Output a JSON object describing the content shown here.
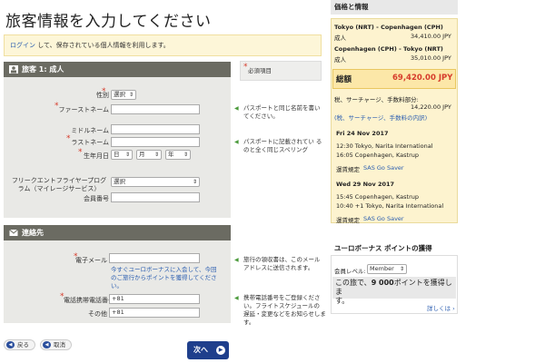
{
  "page": {
    "title": "旅客情報を入力してください"
  },
  "login": {
    "link": "ログイン",
    "text": " して、保存されている個人情報を利用します。"
  },
  "passenger": {
    "header": "旅客 1: 成人",
    "gender_label": "性別",
    "gender_value": "選択",
    "first_name_label": "ファーストネーム",
    "middle_name_label": "ミドルネーム",
    "last_name_label": "ラストネーム",
    "birthdate_label": "生年月日",
    "day_value": "日",
    "month_value": "月",
    "year_value": "年",
    "ffp_label_1": "フリークエントフライヤープログ",
    "ffp_label_2": "ラム（マイレージサービス）",
    "ffp_value": "選択",
    "member_no_label": "会員番号"
  },
  "required_note": "必須項目",
  "help": {
    "first_name_1": "パスポートと同じ名前を書い",
    "first_name_2": "てください。",
    "last_name_1": "パスポートに記載されてい る",
    "last_name_2": "のと全く同じスペリング",
    "email_1": "旅行の領収書は、このメール",
    "email_2": "アドレスに送信されます。",
    "phone_1": "携帯電話番号をご登録くださ",
    "phone_2": "い。フライトスケジュールの",
    "phone_3": "遅延・変更などをお知らせします。"
  },
  "contact": {
    "header": "連絡先",
    "email_label": "電子メール",
    "eurobonus_1": "今すぐユーロボーナスに入会して、今回",
    "eurobonus_2": "のご旅行からポイントを獲得してくださ",
    "eurobonus_3": "い。",
    "phone_label": "電話",
    "mobile_label": "携帯電話番号",
    "mobile_value": "+81",
    "other_label": "その他",
    "other_value": "+81"
  },
  "buttons": {
    "back": "戻る",
    "cancel": "取消",
    "next": "次へ"
  },
  "sidebar": {
    "price_header": "価格と情報",
    "route1": "Tokyo (NRT) - Copenhagen (CPH)",
    "route1_pax": "成人",
    "route1_price": "34,410.00 JPY",
    "route2": "Copenhagen (CPH) - Tokyo (NRT)",
    "route2_pax": "成人",
    "route2_price": "35,010.00 JPY",
    "total_label": "総額",
    "total_value": "69,420.00 JPY",
    "tax_label": "税、サーチャージ、手数料部分:",
    "tax_value": "14,220.00 JPY",
    "tax_link": "(税、サーチャージ、手数料の内訳)",
    "flight1_date": "Fri 24 Nov 2017",
    "flight1_dep": "12:30  Tokyo, Narita International",
    "flight1_arr": "16:05  Copenhagen, Kastrup",
    "flight1_fare_label": "運賃規定",
    "flight1_fare": "SAS Go Saver",
    "flight2_date": "Wed 29 Nov 2017",
    "flight2_dep": "15:45  Copenhagen, Kastrup",
    "flight2_arr": "10:40   +1  Tokyo, Narita International",
    "flight2_fare_label": "運賃規定",
    "flight2_fare": "SAS Go Saver",
    "eb_header": "ユーロボーナス ポイントの獲得",
    "member_level_label": "会員レベル:",
    "member_level_value": "Member",
    "points_text_1": "この旅で、",
    "points_value": "9 000",
    "points_text_2": "ポイントを獲得しま",
    "points_text_3": "す。",
    "details_link": "詳しくは ›"
  },
  "icons": {
    "passenger": "person-icon",
    "contact": "envelope-icon",
    "back": "arrow-left-icon",
    "cancel": "cancel-icon",
    "next": "arrow-right-icon"
  }
}
